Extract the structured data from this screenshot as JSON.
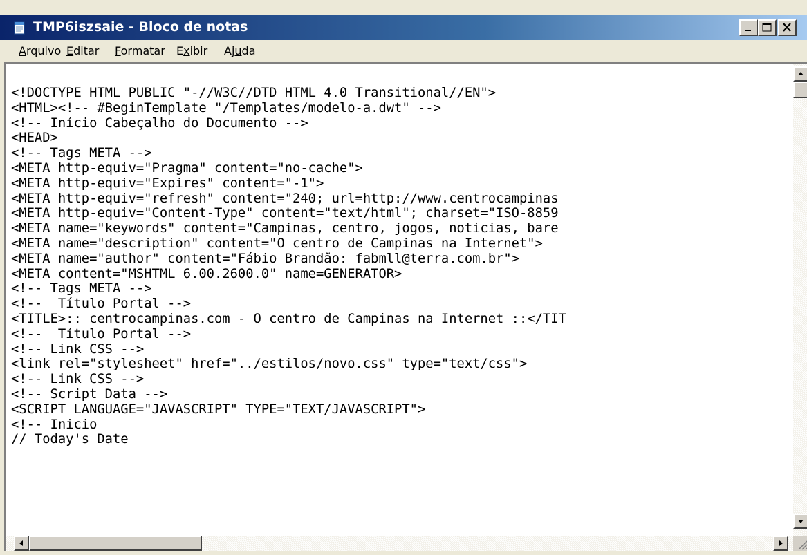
{
  "window": {
    "title": "TMP6iszsaie - Bloco de notas",
    "icon": "notepad-icon"
  },
  "menu": {
    "items": [
      "Arquivo",
      "Editar",
      "Formatar",
      "Exibir",
      "Ajuda"
    ],
    "mnemonics": [
      "A",
      "E",
      "F",
      "x",
      "u"
    ]
  },
  "editor": {
    "lines": [
      "<!DOCTYPE HTML PUBLIC \"-//W3C//DTD HTML 4.0 Transitional//EN\">",
      "<HTML><!-- #BeginTemplate \"/Templates/modelo-a.dwt\" -->",
      "<!-- Início Cabeçalho do Documento -->",
      "<HEAD>",
      "<!-- Tags META -->",
      "<META http-equiv=\"Pragma\" content=\"no-cache\">",
      "<META http-equiv=\"Expires\" content=\"-1\">",
      "<META http-equiv=\"refresh\" content=\"240; url=http://www.centrocampinas",
      "<META http-equiv=\"Content-Type\" content=\"text/html\"; charset=\"ISO-8859",
      "<META name=\"keywords\" content=\"Campinas, centro, jogos, noticias, bare",
      "<META name=\"description\" content=\"O centro de Campinas na Internet\">",
      "<META name=\"author\" content=\"Fábio Brandão: fabmll@terra.com.br\">",
      "<META content=\"MSHTML 6.00.2600.0\" name=GENERATOR>",
      "<!-- Tags META -->",
      "<!--  Título Portal -->",
      "<TITLE>:: centrocampinas.com - O centro de Campinas na Internet ::</TIT",
      "<!--  Título Portal -->",
      "<!-- Link CSS -->",
      "<link rel=\"stylesheet\" href=\"../estilos/novo.css\" type=\"text/css\">",
      "<!-- Link CSS -->",
      "<!-- Script Data -->",
      "<SCRIPT LANGUAGE=\"JAVASCRIPT\" TYPE=\"TEXT/JAVASCRIPT\">",
      "<!-- Inicio",
      "// Today's Date"
    ]
  },
  "colors": {
    "titlebar_start": "#0a246a",
    "titlebar_end": "#a6caf0",
    "chrome": "#ece9d8",
    "button_face": "#d4d0c8"
  }
}
